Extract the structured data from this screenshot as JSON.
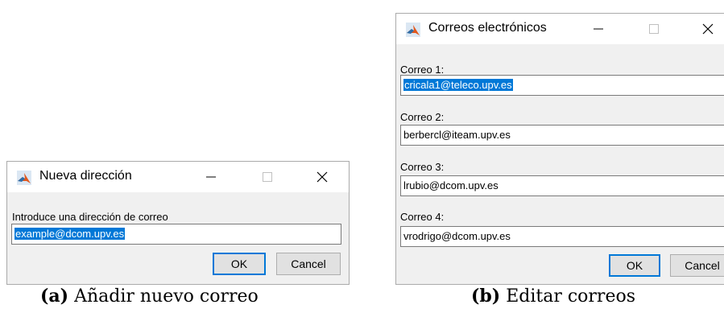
{
  "dialog_a": {
    "title": "Nueva dirección",
    "prompt": "Introduce una dirección de correo",
    "value": "example@dcom.upv.es",
    "ok_label": "OK",
    "cancel_label": "Cancel"
  },
  "dialog_b": {
    "title": "Correos electrónicos",
    "fields": [
      {
        "label": "Correo 1:",
        "value": "cricala1@teleco.upv.es"
      },
      {
        "label": "Correo 2:",
        "value": "berbercl@iteam.upv.es"
      },
      {
        "label": "Correo 3:",
        "value": "lrubio@dcom.upv.es"
      },
      {
        "label": "Correo 4:",
        "value": "vrodrigo@dcom.upv.es"
      }
    ],
    "ok_label": "OK",
    "cancel_label": "Cancel"
  },
  "captions": {
    "a_tag": "(a)",
    "a_text": "Añadir nuevo correo",
    "b_tag": "(b)",
    "b_text": "Editar correos"
  },
  "icons": {
    "app": "matlab-logo-icon",
    "minimize": "minimize-icon",
    "maximize": "maximize-icon",
    "close": "close-icon"
  },
  "colors": {
    "selection": "#0078d7",
    "window_bg": "#f0f0f0"
  }
}
